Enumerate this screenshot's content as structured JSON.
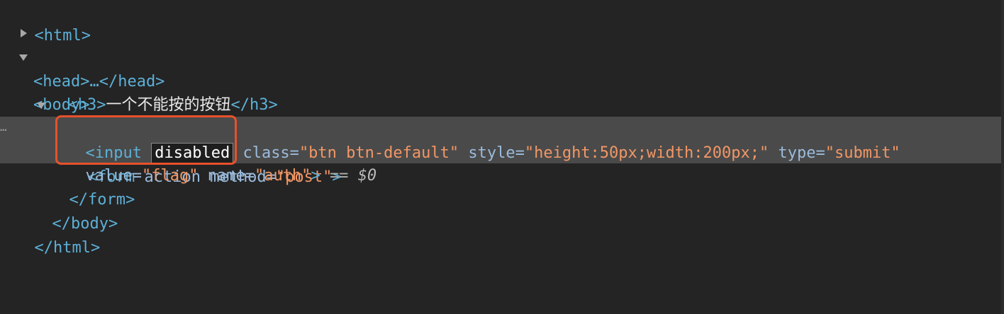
{
  "dom": {
    "html_open": "<html>",
    "head": "<head>…</head>",
    "body_open": "<body>",
    "h3_open": "<h3>",
    "h3_text": "一个不能按的按钮",
    "h3_close": "</h3>",
    "form_tag": "<form",
    "form_attr_action": "action",
    "form_attr_method": "method=",
    "form_method_value": "\"post\"",
    "form_gt": ">",
    "input_tag": "<input",
    "input_attr_disabled": "disabled",
    "input_attr_class_name": "class=",
    "input_class_value": "\"btn btn-default\"",
    "input_attr_style_name": "style=",
    "input_style_value": "\"height:50px;width:200px;\"",
    "input_attr_type_name": "type=",
    "input_type_value": "\"submit\"",
    "input_attr_value_name": "value=",
    "input_value_value": "\"flag\"",
    "input_attr_name_name": "name=",
    "input_name_value": "\"auth\"",
    "input_gt": ">",
    "selected_marker": "==",
    "selected_var": "$0",
    "form_close": "</form>",
    "body_close": "</body>",
    "html_close": "</html>",
    "gutter_dots": "…"
  },
  "colors": {
    "background": "#242424",
    "selected_row": "#4a4a4a",
    "tag": "#5db0d7",
    "attr": "#9bbbdc",
    "value": "#f29766",
    "highlight_border": "#e8512b"
  },
  "icons": {
    "collapsed_triangle": "triangle-right-icon",
    "expanded_triangle": "triangle-down-icon"
  }
}
